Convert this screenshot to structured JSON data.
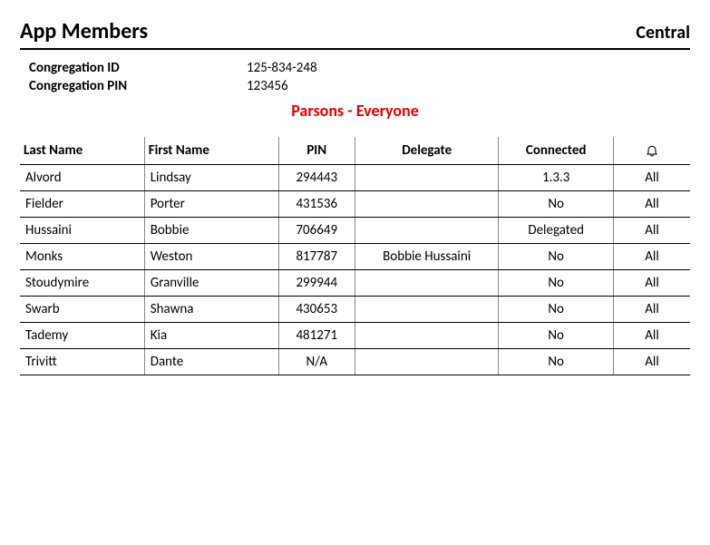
{
  "header": {
    "title": "App Members",
    "right": "Central"
  },
  "meta": {
    "congregation_id_label": "Congregation ID",
    "congregation_id_value": "125-834-248",
    "congregation_pin_label": "Congregation PIN",
    "congregation_pin_value": "123456"
  },
  "subtitle": "Parsons - Everyone",
  "table": {
    "headers": {
      "last_name": "Last Name",
      "first_name": "First Name",
      "pin": "PIN",
      "delegate": "Delegate",
      "connected": "Connected",
      "bell_icon_name": "bell-icon"
    },
    "rows": [
      {
        "last": "Alvord",
        "first": "Lindsay",
        "pin": "294443",
        "delegate": "",
        "connected": "1.3.3",
        "bell": "All"
      },
      {
        "last": "Fielder",
        "first": "Porter",
        "pin": "431536",
        "delegate": "",
        "connected": "No",
        "bell": "All"
      },
      {
        "last": "Hussaini",
        "first": "Bobbie",
        "pin": "706649",
        "delegate": "",
        "connected": "Delegated",
        "bell": "All"
      },
      {
        "last": "Monks",
        "first": "Weston",
        "pin": "817787",
        "delegate": "Bobbie Hussaini",
        "connected": "No",
        "bell": "All"
      },
      {
        "last": "Stoudymire",
        "first": "Granville",
        "pin": "299944",
        "delegate": "",
        "connected": "No",
        "bell": "All"
      },
      {
        "last": "Swarb",
        "first": "Shawna",
        "pin": "430653",
        "delegate": "",
        "connected": "No",
        "bell": "All"
      },
      {
        "last": "Tademy",
        "first": "Kia",
        "pin": "481271",
        "delegate": "",
        "connected": "No",
        "bell": "All"
      },
      {
        "last": "Trivitt",
        "first": "Dante",
        "pin": "N/A",
        "delegate": "",
        "connected": "No",
        "bell": "All"
      }
    ]
  }
}
